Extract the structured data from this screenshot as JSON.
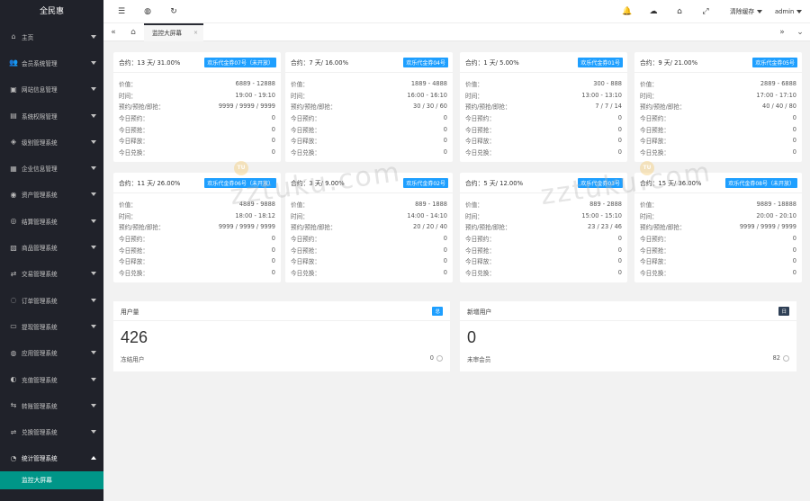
{
  "app": {
    "title": "全民惠"
  },
  "sidebar": {
    "items": [
      {
        "label": "主页",
        "icon": "home-icon",
        "glyph": "⌂"
      },
      {
        "label": "会员系统管理",
        "icon": "users-icon",
        "glyph": "👥"
      },
      {
        "label": "网站信息管理",
        "icon": "website-icon",
        "glyph": "▣"
      },
      {
        "label": "系统权限管理",
        "icon": "permission-icon",
        "glyph": "▤"
      },
      {
        "label": "级别管理系统",
        "icon": "diamond-icon",
        "glyph": "◈"
      },
      {
        "label": "企业信息管理",
        "icon": "enterprise-icon",
        "glyph": "▦"
      },
      {
        "label": "资产管理系统",
        "icon": "asset-icon",
        "glyph": "◉"
      },
      {
        "label": "结算管理系统",
        "icon": "settlement-icon",
        "glyph": "◎"
      },
      {
        "label": "商品管理系统",
        "icon": "goods-icon",
        "glyph": "▨"
      },
      {
        "label": "交易管理系统",
        "icon": "trade-icon",
        "glyph": "⇄"
      },
      {
        "label": "订单管理系统",
        "icon": "order-icon",
        "glyph": "◌"
      },
      {
        "label": "提现管理系统",
        "icon": "withdraw-icon",
        "glyph": "▭"
      },
      {
        "label": "应用管理系统",
        "icon": "app-icon",
        "glyph": "◍"
      },
      {
        "label": "充值管理系统",
        "icon": "recharge-icon",
        "glyph": "◐"
      },
      {
        "label": "转账管理系统",
        "icon": "transfer-icon",
        "glyph": "⇆"
      },
      {
        "label": "兑换管理系统",
        "icon": "exchange-icon",
        "glyph": "⇌"
      },
      {
        "label": "统计管理系统",
        "icon": "stats-icon",
        "glyph": "◔"
      }
    ],
    "sub_item": "监控大屏幕"
  },
  "header": {
    "clear_cache": "清除缓存",
    "user": "admin"
  },
  "tabs": {
    "active": "监控大屏幕",
    "close": "×"
  },
  "cards": [
    {
      "summary": "合约：13 天/ 31.00%",
      "badge": "欢乐代金券07号（未开放）",
      "price": "6889 - 12888",
      "time": "19:00 - 19:10",
      "booking": "9999 / 9999 / 9999"
    },
    {
      "summary": "合约：7 天/ 16.00%",
      "badge": "欢乐代金券04号",
      "price": "1889 - 4888",
      "time": "16:00 - 16:10",
      "booking": "30 / 30 / 60"
    },
    {
      "summary": "合约：1 天/ 5.00%",
      "badge": "欢乐代金券01号",
      "price": "300 - 888",
      "time": "13:00 - 13:10",
      "booking": "7 / 7 / 14"
    },
    {
      "summary": "合约：9 天/ 21.00%",
      "badge": "欢乐代金券05号",
      "price": "2889 - 6888",
      "time": "17:00 - 17:10",
      "booking": "40 / 40 / 80"
    },
    {
      "summary": "合约：11 天/ 26.00%",
      "badge": "欢乐代金券06号（未开放）",
      "price": "4889 - 9888",
      "time": "18:00 - 18:12",
      "booking": "9999 / 9999 / 9999"
    },
    {
      "summary": "合约：3 天/ 9.00%",
      "badge": "欢乐代金券02号",
      "price": "889 - 1888",
      "time": "14:00 - 14:10",
      "booking": "20 / 20 / 40"
    },
    {
      "summary": "合约：5 天/ 12.00%",
      "badge": "欢乐代金券03号",
      "price": "889 - 2888",
      "time": "15:00 - 15:10",
      "booking": "23 / 23 / 46"
    },
    {
      "summary": "合约：15 天/ 36.00%",
      "badge": "欢乐代金券08号（未开放）",
      "price": "9889 - 18888",
      "time": "20:00 - 20:10",
      "booking": "9999 / 9999 / 9999"
    }
  ],
  "card_labels": {
    "price": "价值：",
    "time": "时间：",
    "booking": "预约/预抢/即抢：",
    "today_book": "今日预约：",
    "today_grab": "今日预抢：",
    "today_release": "今日释放：",
    "today_redeem": "今日兑换：",
    "zero": "0"
  },
  "stats": [
    {
      "title": "用户量",
      "tag": "总",
      "tag_color": "#1e9fff",
      "value": "426",
      "sub_label": "冻结用户",
      "sub_value": "0"
    },
    {
      "title": "新增用户",
      "tag": "日",
      "tag_color": "#2f4056",
      "value": "0",
      "sub_label": "未审会员",
      "sub_value": "82"
    }
  ],
  "watermark": {
    "text": "zztuku.com",
    "badge": "TU"
  }
}
